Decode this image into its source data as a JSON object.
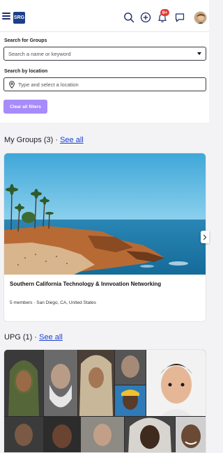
{
  "header": {
    "logo_text": "SRG",
    "notification_badge": "9+",
    "icons": [
      "menu-icon",
      "search-icon",
      "add-circle-icon",
      "bell-icon",
      "chat-icon"
    ]
  },
  "search": {
    "groups_label": "Search for Groups",
    "groups_placeholder": "Search a name or keyword",
    "location_label": "Search by location",
    "location_placeholder": "Type and select a location",
    "clear_button": "Clear all filters"
  },
  "my_groups": {
    "heading": "My Groups (3) ·",
    "see_all": "See all",
    "card": {
      "name": "Southern California Technology & Innvoation Networking",
      "meta": "5 members · San Diego, CA, United States"
    }
  },
  "upg": {
    "heading": "UPG (1) ·",
    "see_all": "See all"
  },
  "colors": {
    "accent_button": "#a78bfa",
    "link": "#1a3fd8",
    "badge": "#e53935",
    "logo": "#1d3f8a"
  }
}
